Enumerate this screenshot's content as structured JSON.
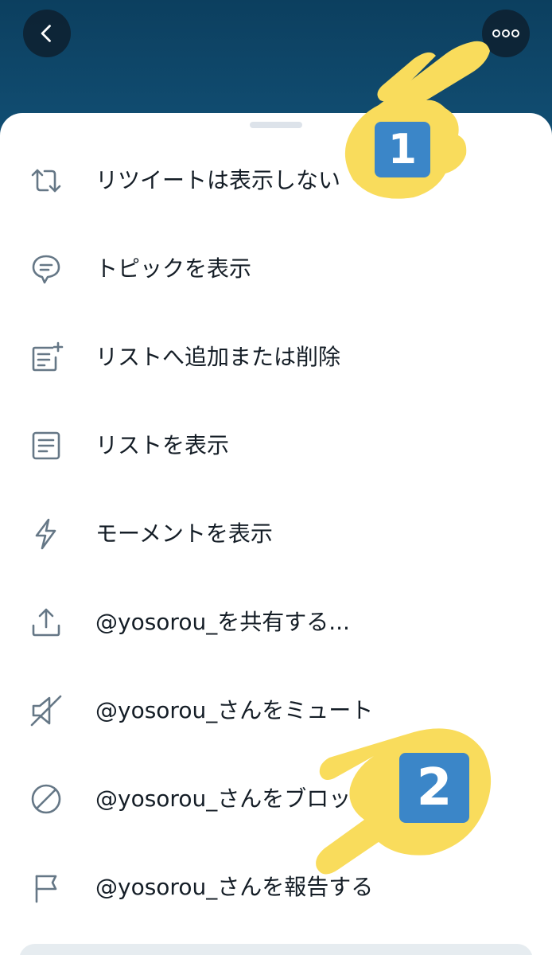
{
  "header": {
    "back_icon": "chevron-left-icon",
    "more_icon": "more-horizontal-icon"
  },
  "menu": {
    "items": [
      {
        "label": "リツイートは表示しない",
        "icon": "retweet-icon"
      },
      {
        "label": "トピックを表示",
        "icon": "topic-bubble-icon"
      },
      {
        "label": "リストへ追加または削除",
        "icon": "list-add-icon"
      },
      {
        "label": "リストを表示",
        "icon": "list-icon"
      },
      {
        "label": "モーメントを表示",
        "icon": "lightning-icon"
      },
      {
        "label": "@yosorou_を共有する...",
        "icon": "share-icon"
      },
      {
        "label": "@yosorou_さんをミュート",
        "icon": "mute-icon"
      },
      {
        "label": "@yosorou_さんをブロック",
        "icon": "block-icon"
      },
      {
        "label": "@yosorou_さんを報告する",
        "icon": "flag-icon"
      }
    ]
  },
  "annotations": {
    "step1": "1",
    "step2": "2",
    "hand_color": "#f9dc5c",
    "badge_color": "#3b86c8"
  },
  "colors": {
    "header_bg": "#0e4a6f",
    "icon_color": "#657786",
    "text_color": "#141d26"
  }
}
